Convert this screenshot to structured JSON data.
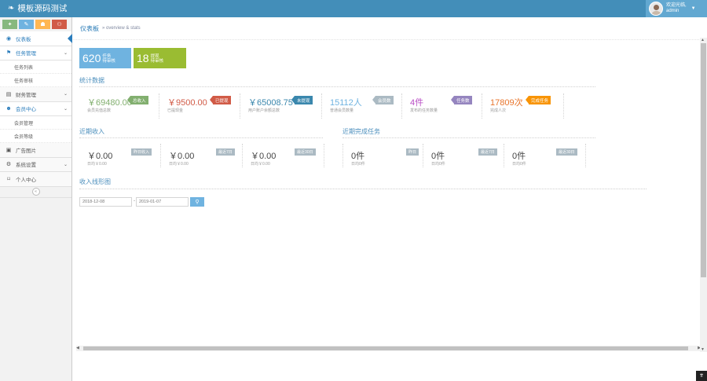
{
  "app": {
    "title": "模板源码测试"
  },
  "user": {
    "welcome": "欢迎光临,",
    "name": "admin"
  },
  "shortcuts": [
    {
      "icon": "signal-icon",
      "glyph": "✦",
      "color": "#87b87f"
    },
    {
      "icon": "pencil-icon",
      "glyph": "✎",
      "color": "#6fb3e0"
    },
    {
      "icon": "users-icon",
      "glyph": "☗",
      "color": "#ffb752"
    },
    {
      "icon": "bell-icon",
      "glyph": "⚇",
      "color": "#d15b47"
    }
  ],
  "sidebar": {
    "dashboard": "仪表板",
    "tasks": "任务管理",
    "task_list": "任务列表",
    "task_review": "任务审核",
    "finance": "财务管理",
    "members": "会员中心",
    "member_mgmt": "会员管理",
    "member_level": "会员等级",
    "ads": "广告图片",
    "system": "系统设置",
    "personal": "个人中心"
  },
  "breadcrumb": {
    "title": "仪表板",
    "subtitle": "» overview & stats"
  },
  "stat_boxes": [
    {
      "num": "620",
      "line1": "任务",
      "line2": "待审核"
    },
    {
      "num": "18",
      "line1": "提现",
      "line2": "待审核"
    }
  ],
  "stats": {
    "title": "统计数据",
    "items": [
      {
        "value": "￥69480.00",
        "label": "会员充值总数",
        "tag": "总收入"
      },
      {
        "value": "￥9500.00",
        "label": "已提现金",
        "tag": "已提现"
      },
      {
        "value": "￥65008.75",
        "label": "用户账户余额总数",
        "tag": "未提现"
      },
      {
        "value": "15112人",
        "label": "普通会员数量",
        "tag": "会员数"
      },
      {
        "value": "4件",
        "label": "发布的任务数量",
        "tag": "任务数"
      },
      {
        "value": "17809次",
        "label": "完成人次",
        "tag": "完成任务"
      }
    ]
  },
  "income": {
    "title": "近期收入",
    "items": [
      {
        "value": "￥0.00",
        "label": "日均￥0.00",
        "tag": "昨日收入"
      },
      {
        "value": "￥0.00",
        "label": "日均￥0.00",
        "tag": "最近7日"
      },
      {
        "value": "￥0.00",
        "label": "日均￥0.00",
        "tag": "最近30日"
      }
    ]
  },
  "completed": {
    "title": "近期完成任务",
    "items": [
      {
        "value": "0件",
        "label": "日均0件",
        "tag": "昨日"
      },
      {
        "value": "0件",
        "label": "日均0件",
        "tag": "最近7日"
      },
      {
        "value": "0件",
        "label": "日均0件",
        "tag": "最近30日"
      }
    ]
  },
  "chart": {
    "title": "收入线形图",
    "start": "2018-12-08",
    "end": "2019-01-07",
    "separator": "-"
  },
  "colors": {
    "navbar": "#438eb9",
    "green": "#82af6f",
    "red": "#d15b47",
    "blue": "#3a87ad",
    "purple": "#9585bf",
    "orange": "#f89406"
  }
}
